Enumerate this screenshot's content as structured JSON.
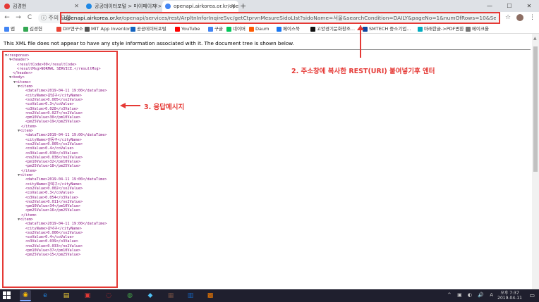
{
  "browser": {
    "tabs": [
      {
        "label": "김경헌",
        "color": "#e53935"
      },
      {
        "label": "공공데이터포털 > 마이페이지 >",
        "color": "#1e88e5"
      },
      {
        "label": "openapi.airkorea.or.kr/openapi/",
        "color": "#4285f4"
      }
    ],
    "new_tab": "+",
    "window_controls": [
      "—",
      "☐",
      "✕"
    ],
    "nav": {
      "back": "←",
      "forward": "→",
      "reload": "C"
    },
    "security_label": "ⓘ 주의 요함",
    "url_host": "openapi.airkorea.or.kr",
    "url_path": "/openapi/services/rest/ArpltnInforInqireSvc/getCtprvnMesureSidoLIst?sidoName=서울&searchCondition=DAILY&pageNo=1&numOfRows=10&ServiceKey=izeMTwO...",
    "star": "☆",
    "menu": "⋮"
  },
  "bookmarks": [
    {
      "label": "앱",
      "color": "#4285f4"
    },
    {
      "label": "김경헌",
      "color": "#34a853"
    },
    {
      "label": "DIY연구소",
      "color": "#ea4335"
    },
    {
      "label": "MIT App Inventor",
      "color": "#555555"
    },
    {
      "label": "공공데이터포털",
      "color": "#1565c0"
    },
    {
      "label": "YouTube",
      "color": "#ff0000"
    },
    {
      "label": "구글",
      "color": "#4285f4"
    },
    {
      "label": "네이버",
      "color": "#03c75a"
    },
    {
      "label": "Daum",
      "color": "#ff5a00"
    },
    {
      "label": "페이스북",
      "color": "#1877f2"
    },
    {
      "label": "고양경기문화창조...",
      "color": "#111111"
    },
    {
      "label": "SMTECH 중소기업...",
      "color": "#0d47a1"
    },
    {
      "label": "마래한글->PDF변환",
      "color": "#00acc1"
    },
    {
      "label": "메이크올",
      "color": "#777777"
    }
  ],
  "content": {
    "xml_banner": "This XML file does not appear to have any style information associated with it. The document tree is shown below.",
    "annotation_url": "2. 주소창에 복사한 REST(URI) 붙여넣기후 엔터",
    "annotation_response": "3. 응답메시지",
    "xml_lines": [
      {
        "indent": 0,
        "arrow": "▼",
        "text": "<response>"
      },
      {
        "indent": 1,
        "arrow": "▼",
        "text": "<header>"
      },
      {
        "indent": 2,
        "arrow": "",
        "text": "<resultCode>00</resultCode>"
      },
      {
        "indent": 2,
        "arrow": "",
        "text": "<resultMsg>NORMAL SERVICE.</resultMsg>"
      },
      {
        "indent": 1,
        "arrow": "",
        "text": "</header>"
      },
      {
        "indent": 1,
        "arrow": "▼",
        "text": "<body>"
      },
      {
        "indent": 2,
        "arrow": "▼",
        "text": "<items>"
      },
      {
        "indent": 3,
        "arrow": "▼",
        "text": "<item>"
      },
      {
        "indent": 4,
        "arrow": "",
        "text": "<dataTime>2019-04-11 19:00</dataTime>"
      },
      {
        "indent": 4,
        "arrow": "",
        "text": "<cityName>강남구</cityName>"
      },
      {
        "indent": 4,
        "arrow": "",
        "text": "<so2Value>0.005</so2Value>"
      },
      {
        "indent": 4,
        "arrow": "",
        "text": "<coValue>0.3</coValue>"
      },
      {
        "indent": 4,
        "arrow": "",
        "text": "<o3Value>0.028</o3Value>"
      },
      {
        "indent": 4,
        "arrow": "",
        "text": "<no2Value>0.027</no2Value>"
      },
      {
        "indent": 4,
        "arrow": "",
        "text": "<pm10Value>30</pm10Value>"
      },
      {
        "indent": 4,
        "arrow": "",
        "text": "<pm25Value>19</pm25Value>"
      },
      {
        "indent": 3,
        "arrow": "",
        "text": "</item>"
      },
      {
        "indent": 3,
        "arrow": "▼",
        "text": "<item>"
      },
      {
        "indent": 4,
        "arrow": "",
        "text": "<dataTime>2019-04-11 19:00</dataTime>"
      },
      {
        "indent": 4,
        "arrow": "",
        "text": "<cityName>강동구</cityName>"
      },
      {
        "indent": 4,
        "arrow": "",
        "text": "<so2Value>0.005</so2Value>"
      },
      {
        "indent": 4,
        "arrow": "",
        "text": "<coValue>0.4</coValue>"
      },
      {
        "indent": 4,
        "arrow": "",
        "text": "<o3Value>0.030</o3Value>"
      },
      {
        "indent": 4,
        "arrow": "",
        "text": "<no2Value>0.038</no2Value>"
      },
      {
        "indent": 4,
        "arrow": "",
        "text": "<pm10Value>32</pm10Value>"
      },
      {
        "indent": 4,
        "arrow": "",
        "text": "<pm25Value>18</pm25Value>"
      },
      {
        "indent": 3,
        "arrow": "",
        "text": "</item>"
      },
      {
        "indent": 3,
        "arrow": "▼",
        "text": "<item>"
      },
      {
        "indent": 4,
        "arrow": "",
        "text": "<dataTime>2019-04-11 19:00</dataTime>"
      },
      {
        "indent": 4,
        "arrow": "",
        "text": "<cityName>강북구</cityName>"
      },
      {
        "indent": 4,
        "arrow": "",
        "text": "<so2Value>0.002</so2Value>"
      },
      {
        "indent": 4,
        "arrow": "",
        "text": "<coValue>0.3</coValue>"
      },
      {
        "indent": 4,
        "arrow": "",
        "text": "<o3Value>0.054</o3Value>"
      },
      {
        "indent": 4,
        "arrow": "",
        "text": "<no2Value>0.011</no2Value>"
      },
      {
        "indent": 4,
        "arrow": "",
        "text": "<pm10Value>34</pm10Value>"
      },
      {
        "indent": 4,
        "arrow": "",
        "text": "<pm25Value>16</pm25Value>"
      },
      {
        "indent": 3,
        "arrow": "",
        "text": "</item>"
      },
      {
        "indent": 3,
        "arrow": "▼",
        "text": "<item>"
      },
      {
        "indent": 4,
        "arrow": "",
        "text": "<dataTime>2019-04-11 19:00</dataTime>"
      },
      {
        "indent": 4,
        "arrow": "",
        "text": "<cityName>강서구</cityName>"
      },
      {
        "indent": 4,
        "arrow": "",
        "text": "<so2Value>0.006</so2Value>"
      },
      {
        "indent": 4,
        "arrow": "",
        "text": "<coValue>0.4</coValue>"
      },
      {
        "indent": 4,
        "arrow": "",
        "text": "<o3Value>0.039</o3Value>"
      },
      {
        "indent": 4,
        "arrow": "",
        "text": "<no2Value>0.033</no2Value>"
      },
      {
        "indent": 4,
        "arrow": "",
        "text": "<pm10Value>37</pm10Value>"
      },
      {
        "indent": 4,
        "arrow": "",
        "text": "<pm25Value>15</pm25Value>"
      }
    ]
  },
  "taskbar": {
    "apps": [
      {
        "name": "chrome",
        "glyph": "◉",
        "color": "#fbbc05"
      },
      {
        "name": "ie",
        "glyph": "e",
        "color": "#1e88e5"
      },
      {
        "name": "explorer",
        "glyph": "▤",
        "color": "#fdd835"
      },
      {
        "name": "office",
        "glyph": "▣",
        "color": "#e53935"
      },
      {
        "name": "capture",
        "glyph": "◌",
        "color": "#d32f2f"
      },
      {
        "name": "kakao",
        "glyph": "◍",
        "color": "#43a047"
      },
      {
        "name": "mail",
        "glyph": "◆",
        "color": "#4fc3f7"
      },
      {
        "name": "app8",
        "glyph": "▦",
        "color": "#6d4c41"
      },
      {
        "name": "docs",
        "glyph": "▥",
        "color": "#1565c0"
      },
      {
        "name": "tool",
        "glyph": "▩",
        "color": "#f57c00"
      }
    ],
    "tray_icons": "^ ▣ ◐ 🔊 A",
    "time": "오후 7:37",
    "date": "2019-04-11",
    "notification": "▭"
  }
}
